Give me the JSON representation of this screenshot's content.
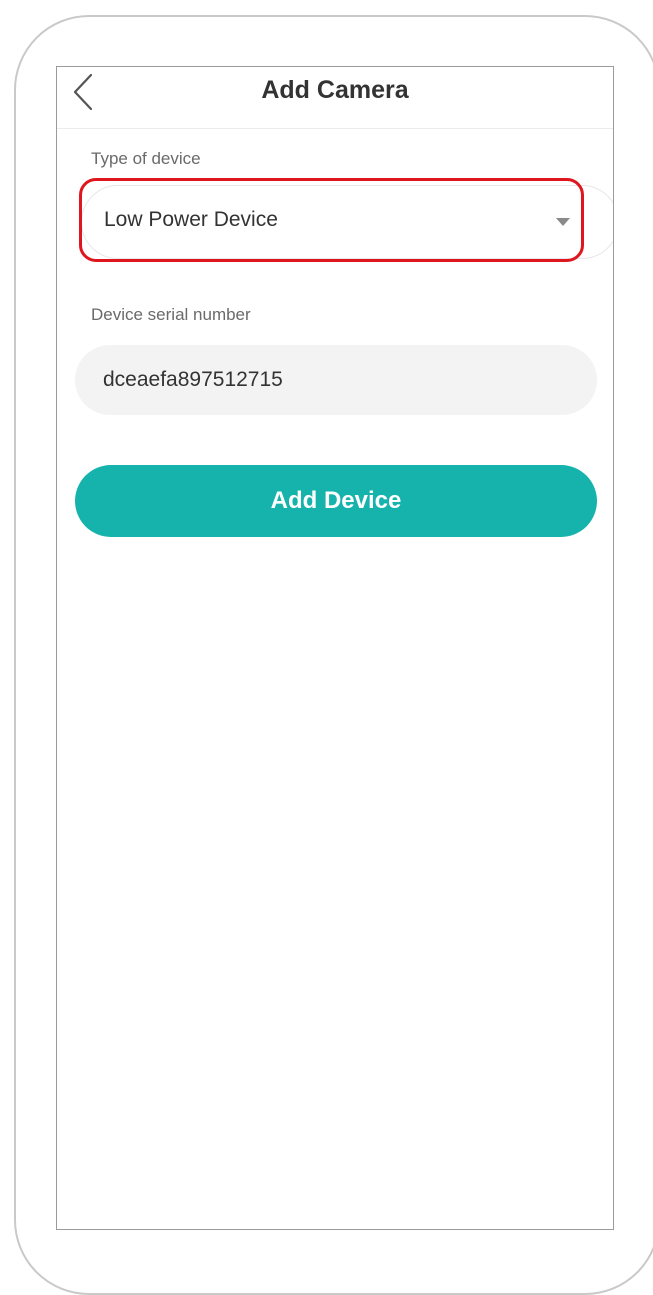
{
  "header": {
    "title": "Add Camera",
    "back_icon": "chevron-left-icon"
  },
  "device_type": {
    "label": "Type of device",
    "selected_value": "Low Power Device",
    "dropdown_icon": "caret-down-icon",
    "highlight_color": "#e0161e"
  },
  "serial": {
    "label": "Device serial number",
    "value": "dceaefa897512715"
  },
  "actions": {
    "add_device_label": "Add Device",
    "button_color": "#16b3ad"
  }
}
